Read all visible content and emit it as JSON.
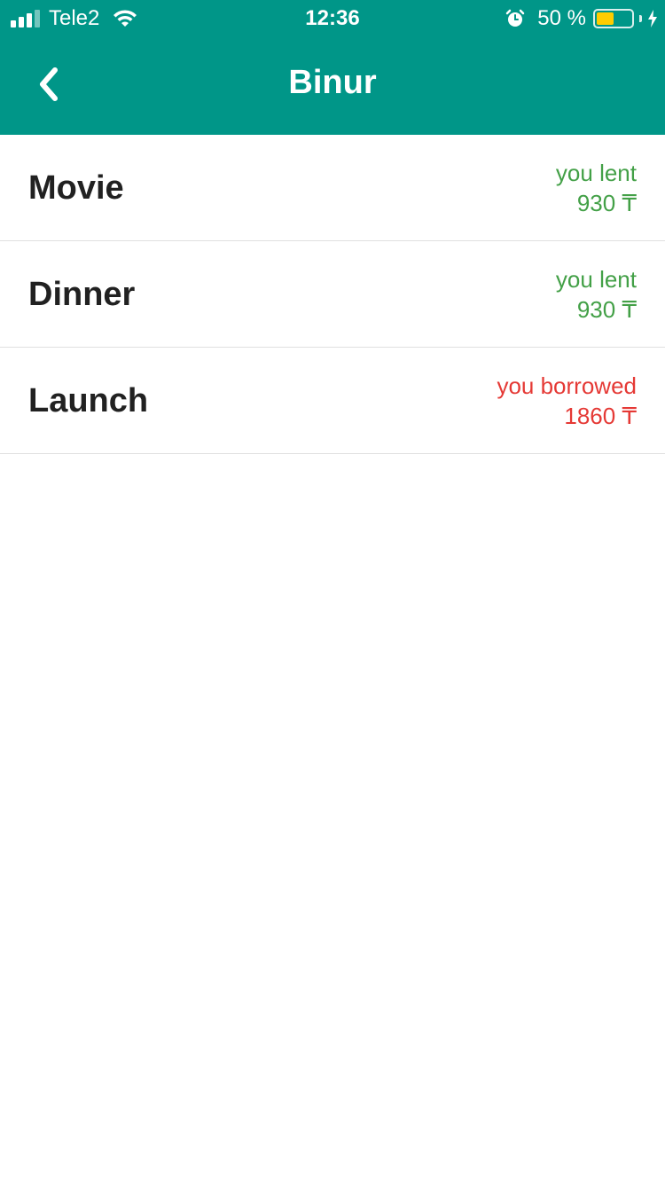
{
  "status_bar": {
    "carrier": "Tele2",
    "time": "12:36",
    "battery_percent": "50 %",
    "battery_level": 0.5,
    "battery_color": "#ffcc00",
    "signal_bars": 3
  },
  "header": {
    "title": "Binur",
    "back_icon": "chevron-left-icon",
    "color": "#009688"
  },
  "transactions": [
    {
      "name": "Movie",
      "status": "you lent",
      "amount": "930 ₸",
      "type": "lent"
    },
    {
      "name": "Dinner",
      "status": "you lent",
      "amount": "930 ₸",
      "type": "lent"
    },
    {
      "name": "Launch",
      "status": "you borrowed",
      "amount": "1860 ₸",
      "type": "borrowed"
    }
  ],
  "colors": {
    "lent": "#43a047",
    "borrowed": "#e53935"
  }
}
